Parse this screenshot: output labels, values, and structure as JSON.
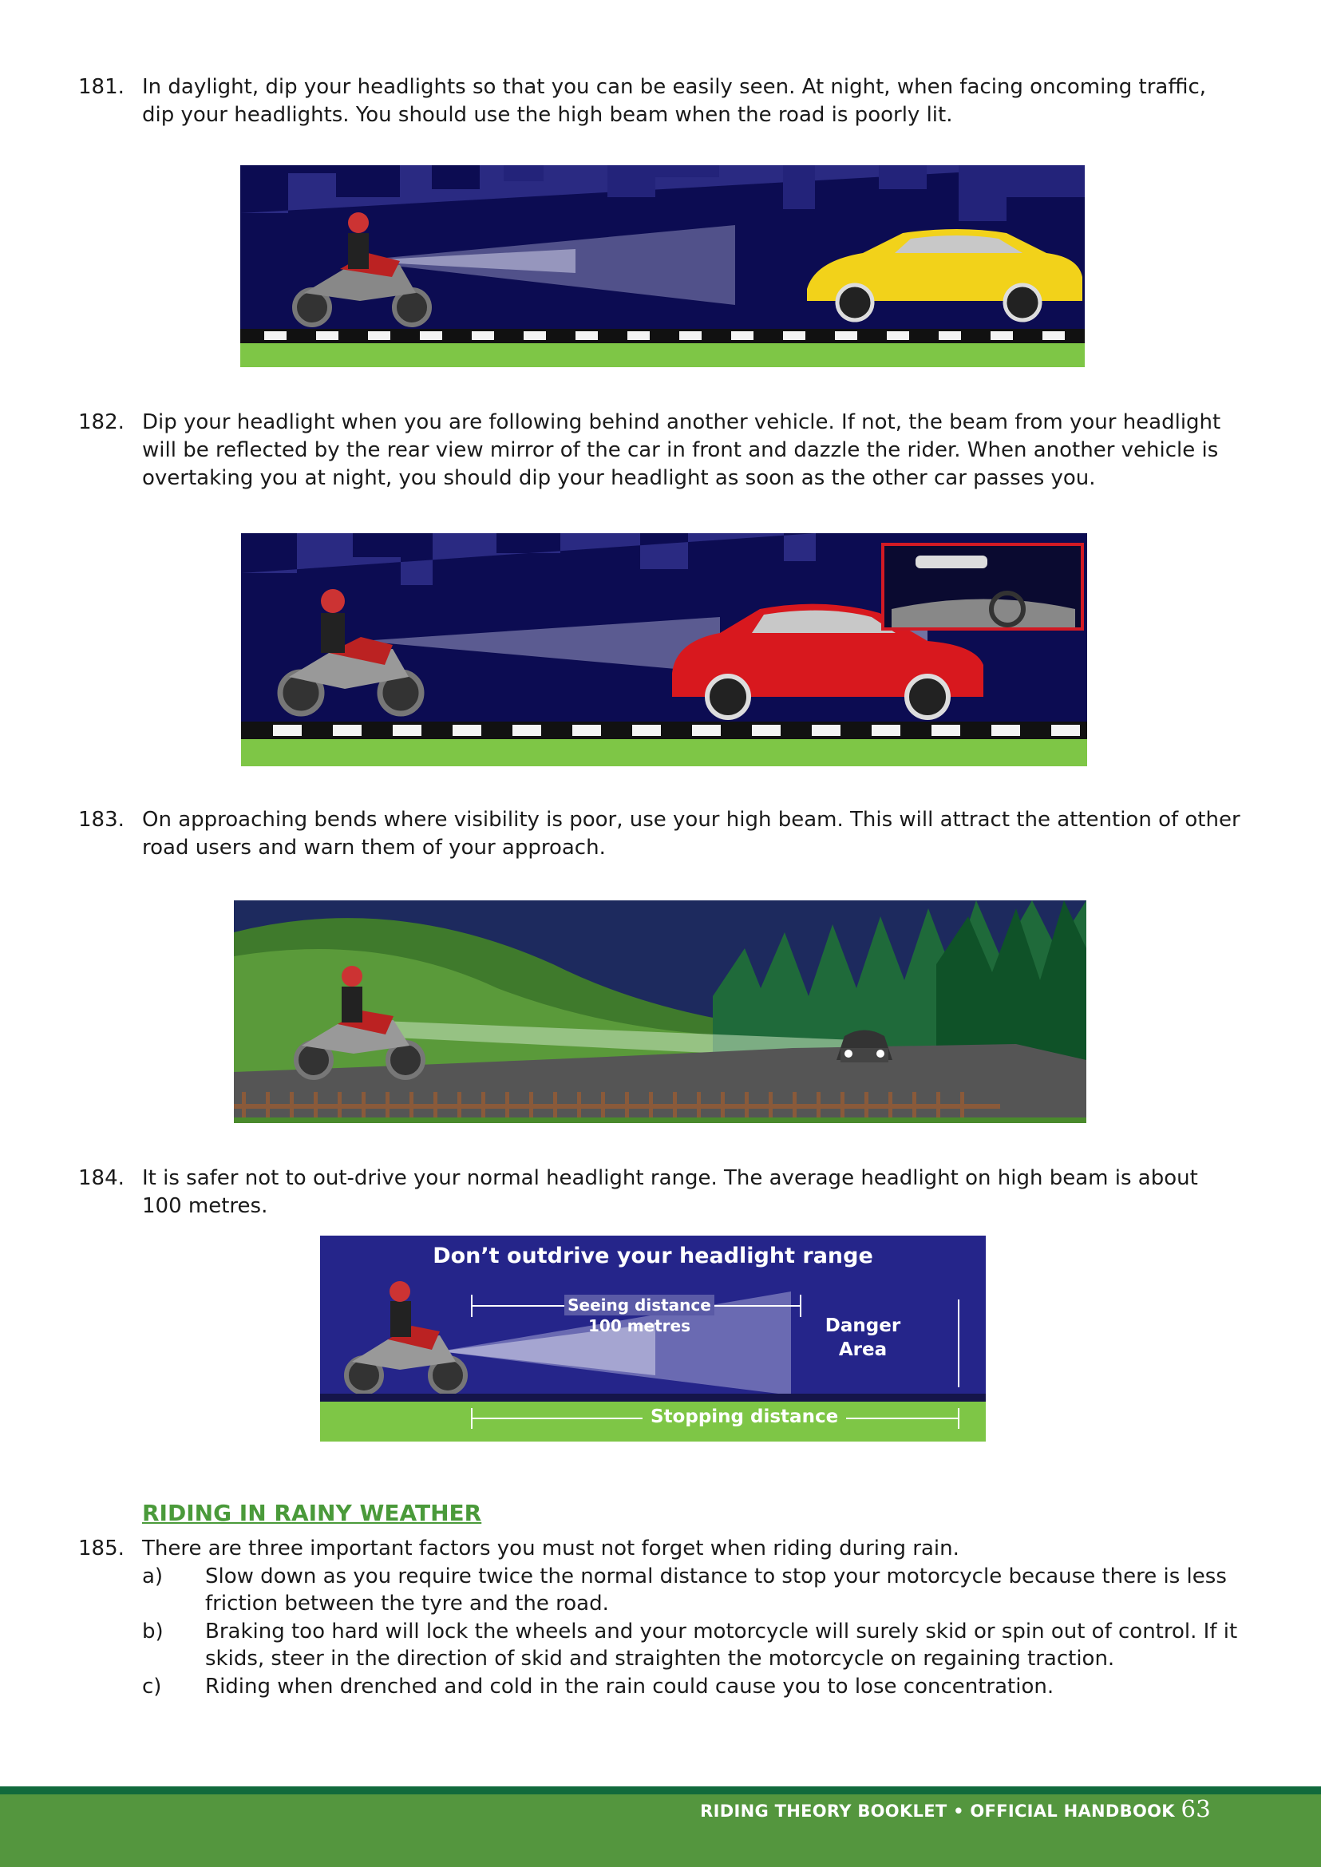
{
  "paragraphs": [
    {
      "number": "181.",
      "text": "In daylight, dip your headlights so that you can be easily seen. At night, when facing oncoming traffic, dip your headlights. You should use the high beam when the road is poorly lit."
    },
    {
      "number": "182.",
      "text": "Dip your headlight when you are following behind another vehicle. If not, the beam from your headlight will be reflected by the rear view mirror of the car in front and dazzle the rider. When another vehicle is overtaking you at night, you should dip your headlight as soon as the other car passes you."
    },
    {
      "number": "183.",
      "text": "On approaching bends where visibility is poor, use your high beam. This will attract the attention of other road users and warn them of your approach."
    },
    {
      "number": "184.",
      "text": "It is safer not to out-drive your normal headlight range. The average headlight on high beam is about 100 metres."
    },
    {
      "number": "185.",
      "text": "There are three important factors you must not forget when riding during rain."
    }
  ],
  "diagram": {
    "title": "Don’t outdrive your headlight range",
    "seeing_label": "Seeing distance",
    "seeing_value": "100 metres",
    "danger_line1": "Danger",
    "danger_line2": "Area",
    "stopping_label": "Stopping distance"
  },
  "section_heading": "RIDING IN RAINY WEATHER",
  "rain_factors": [
    {
      "label": "a)",
      "text": "Slow down as you require twice the normal distance to stop your motorcycle because there is less friction between the tyre and the road."
    },
    {
      "label": "b)",
      "text": "Braking too hard will lock the wheels and your motorcycle will surely skid or spin out of control. If it skids, steer in the direction of skid and straighten the motorcycle on regaining traction."
    },
    {
      "label": "c)",
      "text": "Riding when drenched and cold in the rain could cause you to lose concentration."
    }
  ],
  "footer": {
    "title": "RIDING THEORY BOOKLET • OFFICIAL HANDBOOK",
    "page_number": "63"
  },
  "colors": {
    "night_sky": "#0c0c52",
    "grass": "#7ec646",
    "footer_green": "#54963e",
    "footer_dark": "#116a3c",
    "heading_green": "#4a9a3a"
  }
}
